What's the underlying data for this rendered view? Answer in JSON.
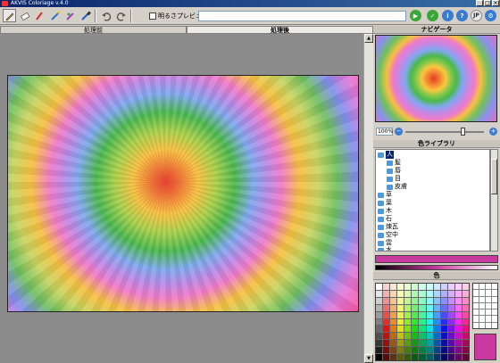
{
  "window": {
    "title": "AKVIS Coloriage v.4.0"
  },
  "toolbar": {
    "preview_label": "明るさプレビュー",
    "path_value": "",
    "tools": [
      "pencil-icon",
      "eraser-icon",
      "brush-icon",
      "magic-brush-icon",
      "stroke-keeper-icon",
      "eyedropper-icon",
      "undo-icon",
      "redo-icon"
    ]
  },
  "tabs": {
    "before": "処理前",
    "after": "処理後"
  },
  "navigator": {
    "title": "ナビゲータ",
    "zoom": "100%"
  },
  "library": {
    "title": "色ライブラリ",
    "items": [
      {
        "label": "人",
        "level": 0,
        "selected": true
      },
      {
        "label": "髪",
        "level": 1
      },
      {
        "label": "唇",
        "level": 1
      },
      {
        "label": "目",
        "level": 1
      },
      {
        "label": "皮膚",
        "level": 1
      },
      {
        "label": "草",
        "level": 0
      },
      {
        "label": "葉",
        "level": 0
      },
      {
        "label": "木",
        "level": 0
      },
      {
        "label": "石",
        "level": 0
      },
      {
        "label": "煉瓦",
        "level": 0
      },
      {
        "label": "空中",
        "level": 0
      },
      {
        "label": "雲",
        "level": 0
      },
      {
        "label": "水",
        "level": 0
      }
    ]
  },
  "color": {
    "title": "色",
    "current": "#c83aa0"
  },
  "colors": {
    "titlebar": "#0a246a",
    "panel": "#d4d0c8",
    "accent_green": "#3aa63a",
    "accent_blue": "#3a7ad0"
  }
}
